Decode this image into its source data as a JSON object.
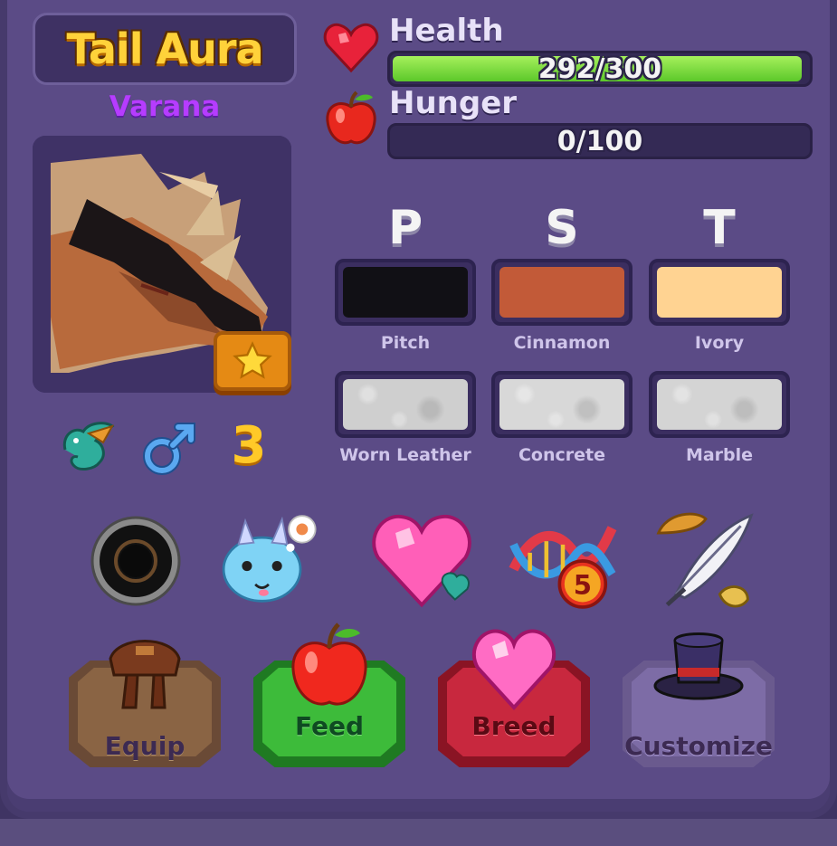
{
  "dragon": {
    "name": "Tail Aura",
    "species": "Varana",
    "level": "3"
  },
  "stats": {
    "health": {
      "label": "Health",
      "value": "292/300",
      "fraction": 0.973
    },
    "hunger": {
      "label": "Hunger",
      "value": "0/100",
      "fraction": 0.0
    }
  },
  "genes": {
    "headers": [
      "P",
      "S",
      "T"
    ],
    "colors": [
      {
        "label": "Pitch",
        "hex": "#111015"
      },
      {
        "label": "Cinnamon",
        "hex": "#c25a38"
      },
      {
        "label": "Ivory",
        "hex": "#ffd392"
      }
    ],
    "textures": [
      {
        "label": "Worn Leather"
      },
      {
        "label": "Concrete"
      },
      {
        "label": "Marble"
      }
    ]
  },
  "attributes": {
    "species_icon": "teal-dragon-icon",
    "gender_icon": "male-symbol-icon"
  },
  "items": [
    {
      "icon": "black-ring-icon"
    },
    {
      "icon": "dragon-mood-icon"
    },
    {
      "icon": "breed-heart-icon"
    },
    {
      "icon": "dna-icon",
      "badge": "5"
    },
    {
      "icon": "feather-hat-icon"
    }
  ],
  "actions": {
    "equip": "Equip",
    "feed": "Feed",
    "breed": "Breed",
    "customize": "Customize"
  },
  "colors": {
    "panel": "#5b4b86",
    "gold_text": "#ffd23a",
    "species_text": "#b63cff",
    "health_bar": "#7ad83a",
    "feed_button": "#3dbb3a",
    "breed_button": "#c8283e"
  }
}
